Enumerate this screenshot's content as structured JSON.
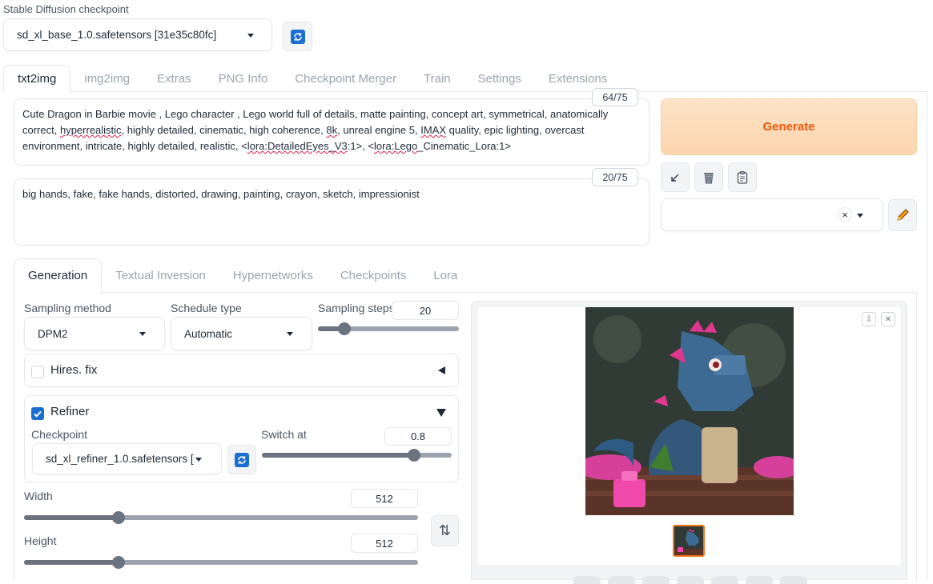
{
  "checkpoint": {
    "label": "Stable Diffusion checkpoint",
    "value": "sd_xl_base_1.0.safetensors [31e35c80fc]"
  },
  "main_tabs": [
    "txt2img",
    "img2img",
    "Extras",
    "PNG Info",
    "Checkpoint Merger",
    "Train",
    "Settings",
    "Extensions"
  ],
  "prompt": {
    "counter": "64/75",
    "seg1": "Cute Dragon in Barbie movie , Lego character , Lego world  full of details, matte painting, concept art, symmetrical, anatomically correct, ",
    "seg2": "hyperrealistic",
    "seg3": ", highly detailed, cinematic, high coherence, ",
    "seg4": "8k",
    "seg5": ", unreal engine 5, ",
    "seg6": "IMAX",
    "seg7": " quality, epic lighting, overcast environment, intricate, highly detailed, realistic, <",
    "seg8": "lora:DetailedEyes_V3",
    "seg9": ":1>, <",
    "seg10": "lora:Lego",
    "seg11": "_Cinematic_Lora:1>"
  },
  "negative_prompt": {
    "counter": "20/75",
    "text": "big hands, fake, fake hands, distorted, drawing, painting, crayon, sketch, impressionist"
  },
  "generate_label": "Generate",
  "style_select": {
    "clear": "×"
  },
  "sub_tabs": [
    "Generation",
    "Textual Inversion",
    "Hypernetworks",
    "Checkpoints",
    "Lora"
  ],
  "sampling": {
    "method_label": "Sampling method",
    "method_value": "DPM2",
    "schedule_label": "Schedule type",
    "schedule_value": "Automatic",
    "steps_label": "Sampling steps",
    "steps_value": "20",
    "steps_fraction": 0.19
  },
  "hires": {
    "label": "Hires. fix",
    "checked": false
  },
  "refiner": {
    "label": "Refiner",
    "checked": true,
    "checkpoint_label": "Checkpoint",
    "checkpoint_value": "sd_xl_refiner_1.0.safetensors [",
    "switch_label": "Switch at",
    "switch_value": "0.8",
    "switch_fraction": 0.8
  },
  "width": {
    "label": "Width",
    "value": "512",
    "fraction": 0.24
  },
  "height": {
    "label": "Height",
    "value": "512",
    "fraction": 0.24
  },
  "swap_icon": "⇅",
  "output": {
    "download": "⇩",
    "close": "✕"
  },
  "colors": {
    "generate_bg": "#fddcb8",
    "generate_text": "#ea580c",
    "accent": "#1a6fd3",
    "thumb_border": "#f97316"
  }
}
